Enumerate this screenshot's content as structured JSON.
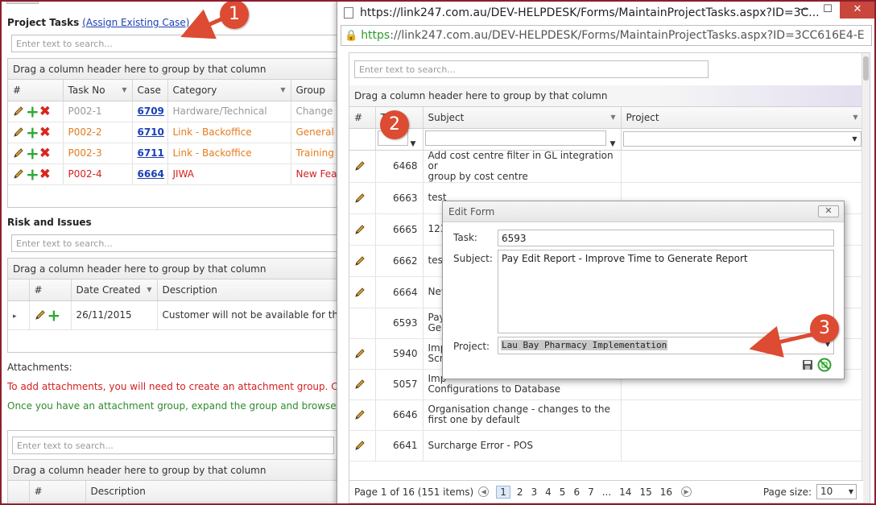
{
  "left": {
    "project_tasks": {
      "title": "Project Tasks",
      "assign_link": "(Assign Existing Case)",
      "search_placeholder": "Enter text to search...",
      "group_hint": "Drag a column header here to group by that column",
      "columns": [
        "#",
        "Task No",
        "Case",
        "Category",
        "Group"
      ],
      "rows": [
        {
          "task_no": "P002-1",
          "case": "6709",
          "category": "Hardware/Technical",
          "group": "Change"
        },
        {
          "task_no": "P002-2",
          "case": "6710",
          "category": "Link - Backoffice",
          "group": "General"
        },
        {
          "task_no": "P002-3",
          "case": "6711",
          "category": "Link - Backoffice",
          "group": "Training"
        },
        {
          "task_no": "P002-4",
          "case": "6664",
          "category": "JIWA",
          "group": "New Fea"
        }
      ]
    },
    "risk": {
      "title": "Risk and Issues",
      "search_placeholder": "Enter text to search...",
      "group_hint": "Drag a column header here to group by that column",
      "columns": [
        "#",
        "Date Created",
        "Description"
      ],
      "rows": [
        {
          "date": "26/11/2015",
          "description": "Customer will not be available for the"
        }
      ]
    },
    "attachments": {
      "title": "Attachments:",
      "note_red": "To add attachments, you will need to create an attachment group. Click",
      "note_green": "Once you have an attachment group, expand the group and browse to",
      "search_placeholder": "Enter text to search...",
      "group_hint": "Drag a column header here to group by that column",
      "columns": [
        "#",
        "Description"
      ]
    }
  },
  "popup": {
    "title_url": "https://link247.com.au/DEV-HELPDESK/Forms/MaintainProjectTasks.aspx?ID=3C...",
    "address_scheme": "https",
    "address_rest": "://link247.com.au/DEV-HELPDESK/Forms/MaintainProjectTasks.aspx?ID=3CC616E4-E",
    "win_minimize": "—",
    "win_maximize": "☐",
    "win_close": "✕",
    "search_placeholder": "Enter text to search...",
    "group_hint": "Drag a column header here to group by that column",
    "columns": [
      "#",
      "Ta",
      "Subject",
      "Project"
    ],
    "rows": [
      {
        "task": "6468",
        "subject_1": "Add cost centre filter in GL integration or",
        "subject_2": "group by cost centre",
        "edit": true
      },
      {
        "task": "6663",
        "subject_1": "test",
        "subject_2": "",
        "edit": true
      },
      {
        "task": "6665",
        "subject_1": "123",
        "subject_2": "",
        "edit": true
      },
      {
        "task": "6662",
        "subject_1": "test",
        "subject_2": "",
        "edit": true
      },
      {
        "task": "6664",
        "subject_1": "New",
        "subject_2": "",
        "edit": true
      },
      {
        "task": "6593",
        "subject_1": "Pay",
        "subject_2": "Gen",
        "edit": false
      },
      {
        "task": "5940",
        "subject_1": "Imp",
        "subject_2": "Scr",
        "edit": true
      },
      {
        "task": "5057",
        "subject_1": "Imp",
        "subject_2": "Configurations to Database",
        "edit": true
      },
      {
        "task": "6646",
        "subject_1": "Organisation change - changes to the",
        "subject_2": "first one by default",
        "edit": true
      },
      {
        "task": "6641",
        "subject_1": "Surcharge Error - POS",
        "subject_2": "",
        "edit": true
      }
    ],
    "pager": {
      "info": "Page 1 of 16 (151 items)",
      "pages": [
        "1",
        "2",
        "3",
        "4",
        "5",
        "6",
        "7",
        "...",
        "14",
        "15",
        "16"
      ],
      "page_size_label": "Page size:",
      "page_size": "10"
    }
  },
  "edit_form": {
    "title": "Edit Form",
    "close": "✕",
    "task_label": "Task:",
    "task_value": "6593",
    "subject_label": "Subject:",
    "subject_value": "Pay Edit Report - Improve Time to Generate Report",
    "project_label": "Project:",
    "project_value": "Lau Bay Pharmacy Implementation"
  },
  "callouts": {
    "one": "1",
    "two": "2",
    "three": "3"
  },
  "colors": {
    "accent_red": "#dc4b32",
    "link_blue": "#1a3fb5",
    "row_orange": "#e57c1e",
    "row_red": "#d42020",
    "frame": "#8b1e2d"
  }
}
